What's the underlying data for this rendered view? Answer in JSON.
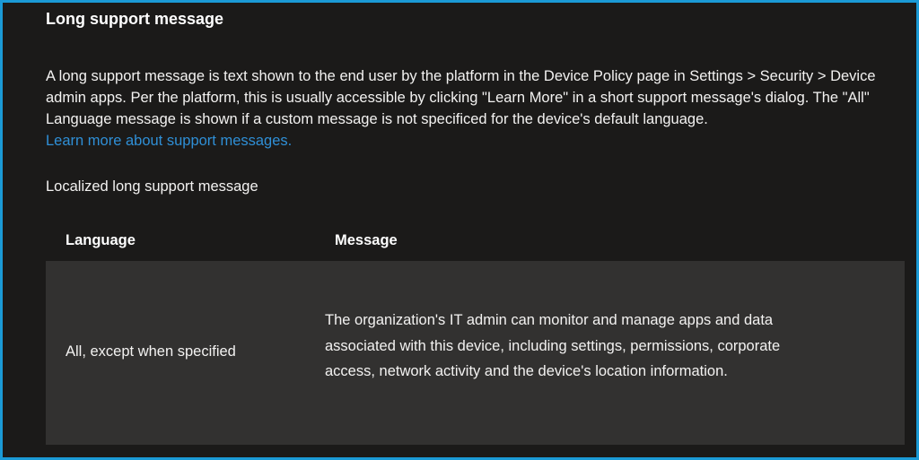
{
  "panel": {
    "title": "Long support message",
    "description": "A long support message is text shown to the end user by the platform in the Device Policy page in Settings > Security > Device admin apps. Per the platform, this is usually accessible by clicking \"Learn More\" in a short support message's dialog. The \"All\" Language message is shown if a custom message is not specificed for the device's default language.",
    "learn_more_link": "Learn more about support messages.",
    "section_label": "Localized long support message"
  },
  "table": {
    "headers": {
      "language": "Language",
      "message": "Message"
    },
    "rows": [
      {
        "language": "All, except when specified",
        "message": "The organization's IT admin can monitor and manage apps and data associated with this device, including settings, permissions, corporate access, network activity and the device's location information."
      }
    ]
  },
  "colors": {
    "background": "#1b1a19",
    "border_accent": "#1b9ad6",
    "row_background": "#323130",
    "link": "#2f8fd6",
    "text": "#f3f2f1"
  }
}
